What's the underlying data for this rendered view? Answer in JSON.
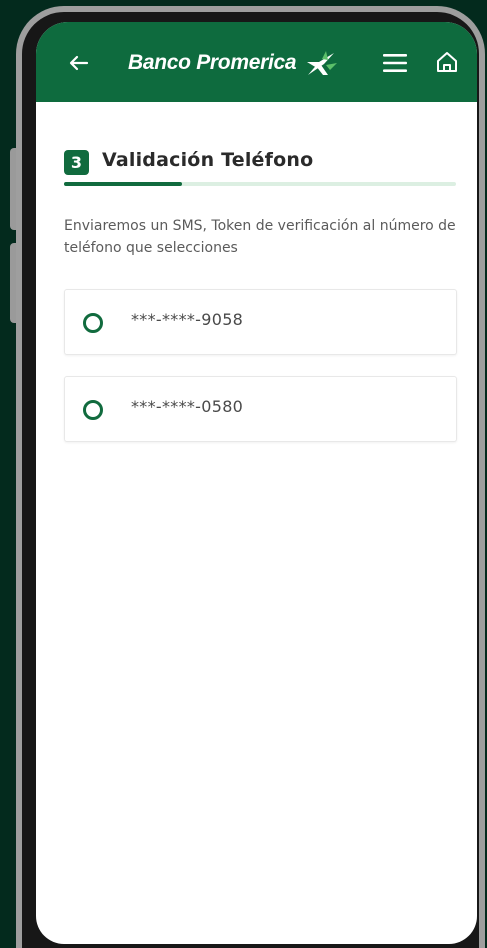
{
  "header": {
    "brand_name": "Banco Promerica",
    "back_icon": "arrow-left-icon",
    "menu_icon": "hamburger-menu-icon",
    "home_icon": "home-icon",
    "bar_color": "#0e6b3e"
  },
  "step": {
    "number": "3",
    "title": "Validación Teléfono",
    "progress": 0.3
  },
  "description": "Enviaremos un SMS, Token de verificación al número de teléfono que selecciones",
  "phones": [
    {
      "label": "***-****-9058",
      "selected": false
    },
    {
      "label": "***-****-0580",
      "selected": false
    }
  ],
  "colors": {
    "accent": "#116b3e",
    "progress_track": "#dcefe2",
    "frame_background": "#032a1d"
  }
}
